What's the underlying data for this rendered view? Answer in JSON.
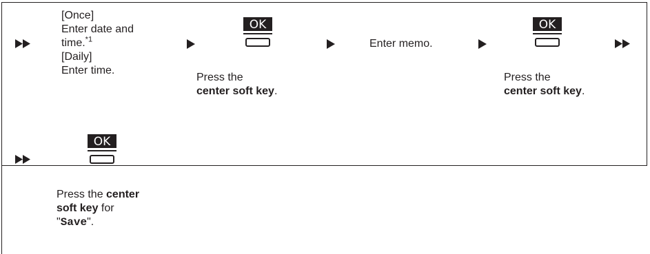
{
  "row1": {
    "step1": {
      "line1": "[Once]",
      "line2": "Enter date and",
      "line3": "time.",
      "footnote": "*1",
      "line4": "[Daily]",
      "line5": "Enter time."
    },
    "step2": {
      "icon_label": "OK",
      "line1": "Press the",
      "bold": "center soft key",
      "end": "."
    },
    "step3": {
      "text": "Enter memo."
    },
    "step4": {
      "icon_label": "OK",
      "line1": "Press the",
      "bold": "center soft key",
      "end": "."
    }
  },
  "row2": {
    "step5": {
      "icon_label": "OK",
      "pre": "Press the ",
      "bold1": "center",
      "bold2": "soft key",
      "mid": " for",
      "quote_open": "\"",
      "mono": "Save",
      "quote_close": "\"."
    }
  }
}
